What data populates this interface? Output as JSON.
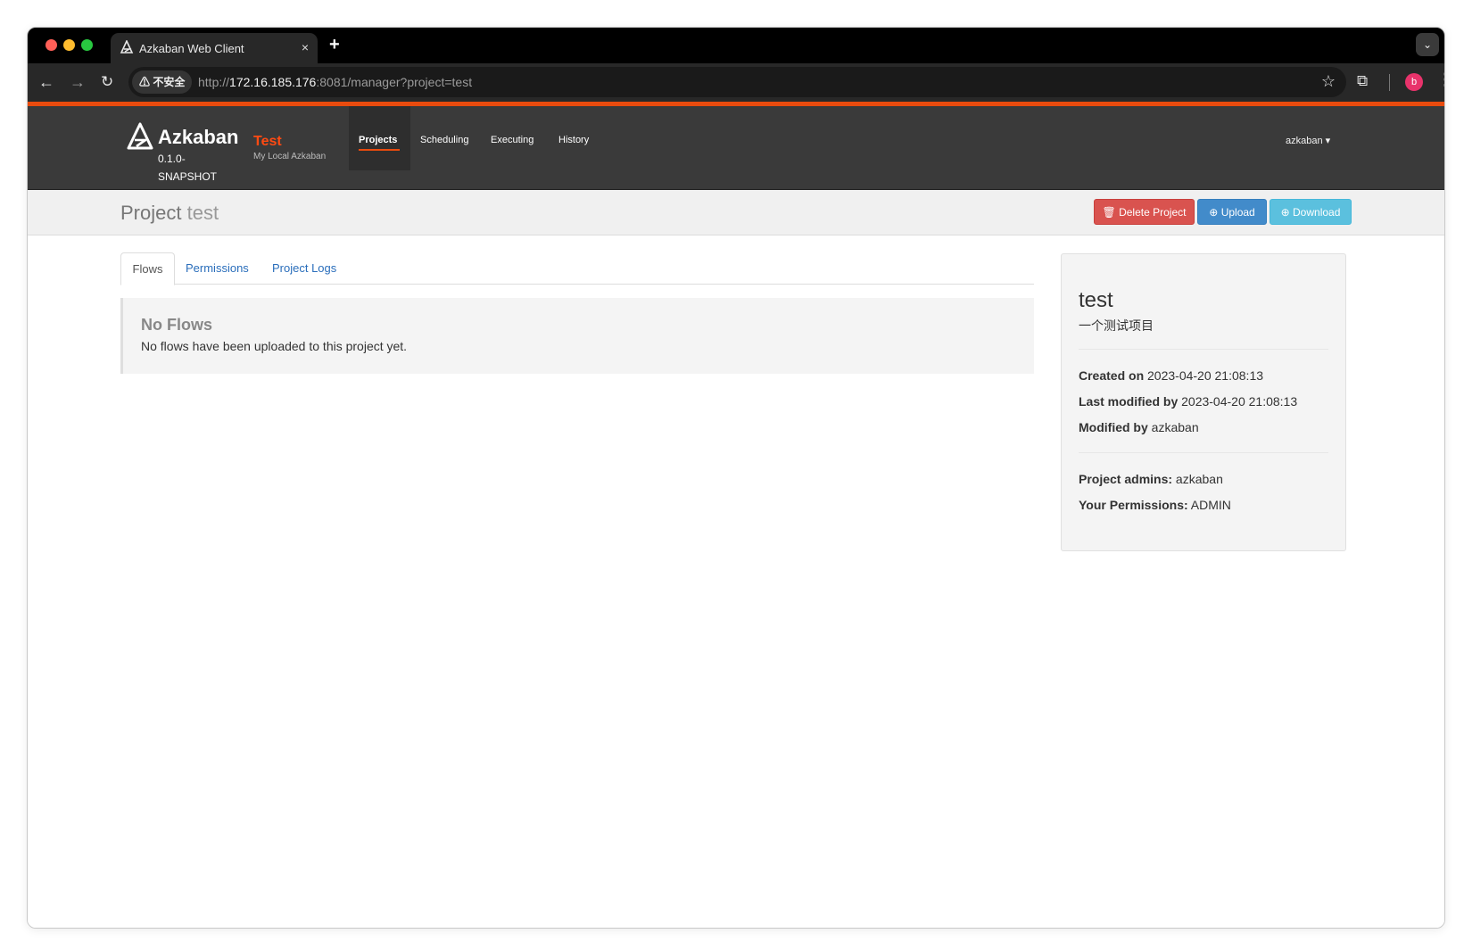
{
  "browser": {
    "tab_title": "Azkaban Web Client",
    "tab_close": "×",
    "new_tab": "+",
    "tab_search": "⌄",
    "security_label": "⚠ 不安全",
    "url_scheme": "http://",
    "url_host": "172.16.185.176",
    "url_rest": ":8081/manager?project=test",
    "profile_initial": "b"
  },
  "navbar": {
    "brand_name": "Azkaban",
    "brand_version": "0.1.0-SNAPSHOT",
    "env_name": "Test",
    "env_desc": "My Local Azkaban",
    "links": [
      "Projects",
      "Scheduling",
      "Executing",
      "History"
    ],
    "user": "azkaban ▾"
  },
  "subheader": {
    "title_prefix": "Project",
    "project_name": "test",
    "delete_label": "Delete Project",
    "upload_label": "Upload",
    "download_label": "Download"
  },
  "tabs": [
    "Flows",
    "Permissions",
    "Project Logs"
  ],
  "flows": {
    "title": "No Flows",
    "message": "No flows have been uploaded to this project yet."
  },
  "project_info": {
    "name": "test",
    "description": "一个测试项目",
    "created_label": "Created on",
    "created_value": "2023-04-20 21:08:13",
    "modified_label": "Last modified by",
    "modified_value": "2023-04-20 21:08:13",
    "modified_by_label": "Modified by",
    "modified_by_value": "azkaban",
    "admins_label": "Project admins:",
    "admins_value": "azkaban",
    "permissions_label": "Your Permissions:",
    "permissions_value": "ADMIN"
  },
  "colors": {
    "accent_orange": "#e94b0e",
    "navbar_bg": "#3a3a3a",
    "danger": "#d9534f",
    "primary": "#428bca",
    "info": "#5bc0de"
  }
}
